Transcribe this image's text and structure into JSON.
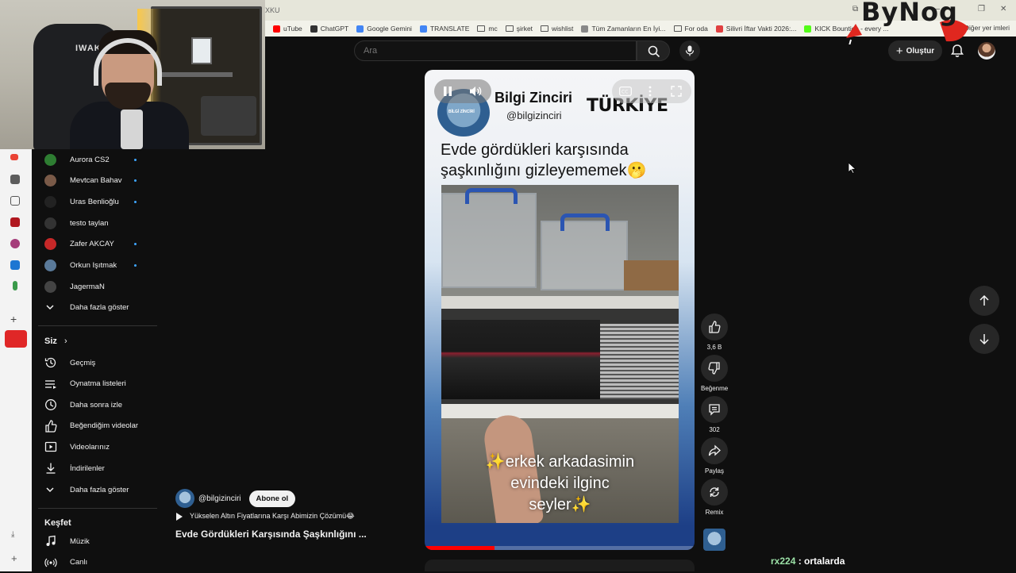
{
  "browser": {
    "tab_text": "XKU",
    "bookmarks": [
      {
        "label": "uTube",
        "icon": "youtube-icon",
        "color": "#ff0000"
      },
      {
        "label": "ChatGPT",
        "icon": "chatgpt-icon",
        "color": "#333333"
      },
      {
        "label": "Google Gemini",
        "icon": "gemini-icon",
        "color": "#4285f4"
      },
      {
        "label": "TRANSLATE",
        "icon": "translate-icon",
        "color": "#4285f4"
      },
      {
        "label": "mc",
        "icon": "folder-icon",
        "color": ""
      },
      {
        "label": "şirket",
        "icon": "folder-icon",
        "color": ""
      },
      {
        "label": "wishlist",
        "icon": "folder-icon",
        "color": ""
      },
      {
        "label": "Tüm Zamanların En İyi...",
        "icon": "link-icon",
        "color": "#888888"
      },
      {
        "label": "For oda",
        "icon": "folder-icon",
        "color": ""
      },
      {
        "label": "Silivri İftar Vakti 2026:...",
        "icon": "page-icon",
        "color": "#e04040"
      },
      {
        "label": "KICK Bounties - every ...",
        "icon": "kick-icon",
        "color": "#53fc18"
      }
    ],
    "other_bookmarks": "Diğer yer imleri"
  },
  "overlay": {
    "logo_text": "ByNog",
    "chair_text": "IWAK"
  },
  "header": {
    "search_placeholder": "Ara",
    "create_label": "Oluştur"
  },
  "sidebar": {
    "subscriptions": [
      {
        "label": "Aurora CS2",
        "dot": true,
        "color": "#2e7d32"
      },
      {
        "label": "Mevtcan Bahav",
        "dot": true,
        "color": "#7a5a48"
      },
      {
        "label": "Uras Benlioğlu",
        "dot": true,
        "color": "#222222"
      },
      {
        "label": "testo taylan",
        "dot": false,
        "color": "#333333"
      },
      {
        "label": "Zafer AKCAY",
        "dot": true,
        "color": "#c62828"
      },
      {
        "label": "Orkun Işıtmak",
        "dot": true,
        "color": "#5a7a9a"
      },
      {
        "label": "JagermaN",
        "dot": false,
        "color": "#444444"
      }
    ],
    "show_more_1": "Daha fazla göster",
    "you_title": "Siz",
    "you_items": [
      {
        "label": "Geçmiş",
        "icon": "history-icon"
      },
      {
        "label": "Oynatma listeleri",
        "icon": "playlists-icon"
      },
      {
        "label": "Daha sonra izle",
        "icon": "watch-later-icon"
      },
      {
        "label": "Beğendiğim videolar",
        "icon": "liked-icon"
      },
      {
        "label": "Videolarınız",
        "icon": "your-videos-icon"
      },
      {
        "label": "İndirilenler",
        "icon": "downloads-icon"
      }
    ],
    "show_more_2": "Daha fazla göster",
    "explore_title": "Keşfet",
    "explore_items": [
      {
        "label": "Müzik",
        "icon": "music-icon"
      },
      {
        "label": "Canlı",
        "icon": "live-icon"
      }
    ]
  },
  "short": {
    "channel_title": "Bilgi Zinciri",
    "channel_handle": "@bilgizinciri",
    "brand_word": "TÜRKİYE",
    "avatar_text": "BİLGİ ZİNCİRİ",
    "caption_line1": "Evde gördükleri karşısında",
    "caption_line2": "şaşkınlığını gizleyememek🫢",
    "video_text_line1": "✨erkek arkadasimin",
    "video_text_line2": "evindeki ilginc",
    "video_text_line3": "seyler✨",
    "progress": 0.26
  },
  "below": {
    "channel": "@bilgizinciri",
    "subscribe": "Abone ol",
    "playlist": "Yükselen Altın Fiyatlarına Karşı Abimizin Çözümü😂",
    "title": "Evde Gördükleri Karşısında Şaşkınlığını ..."
  },
  "actions": {
    "likes": "3,6 B",
    "dislike": "Beğenme",
    "comments": "302",
    "share": "Paylaş",
    "remix": "Remix"
  },
  "chat": {
    "user": "rx224",
    "message": " : ortalarda"
  }
}
